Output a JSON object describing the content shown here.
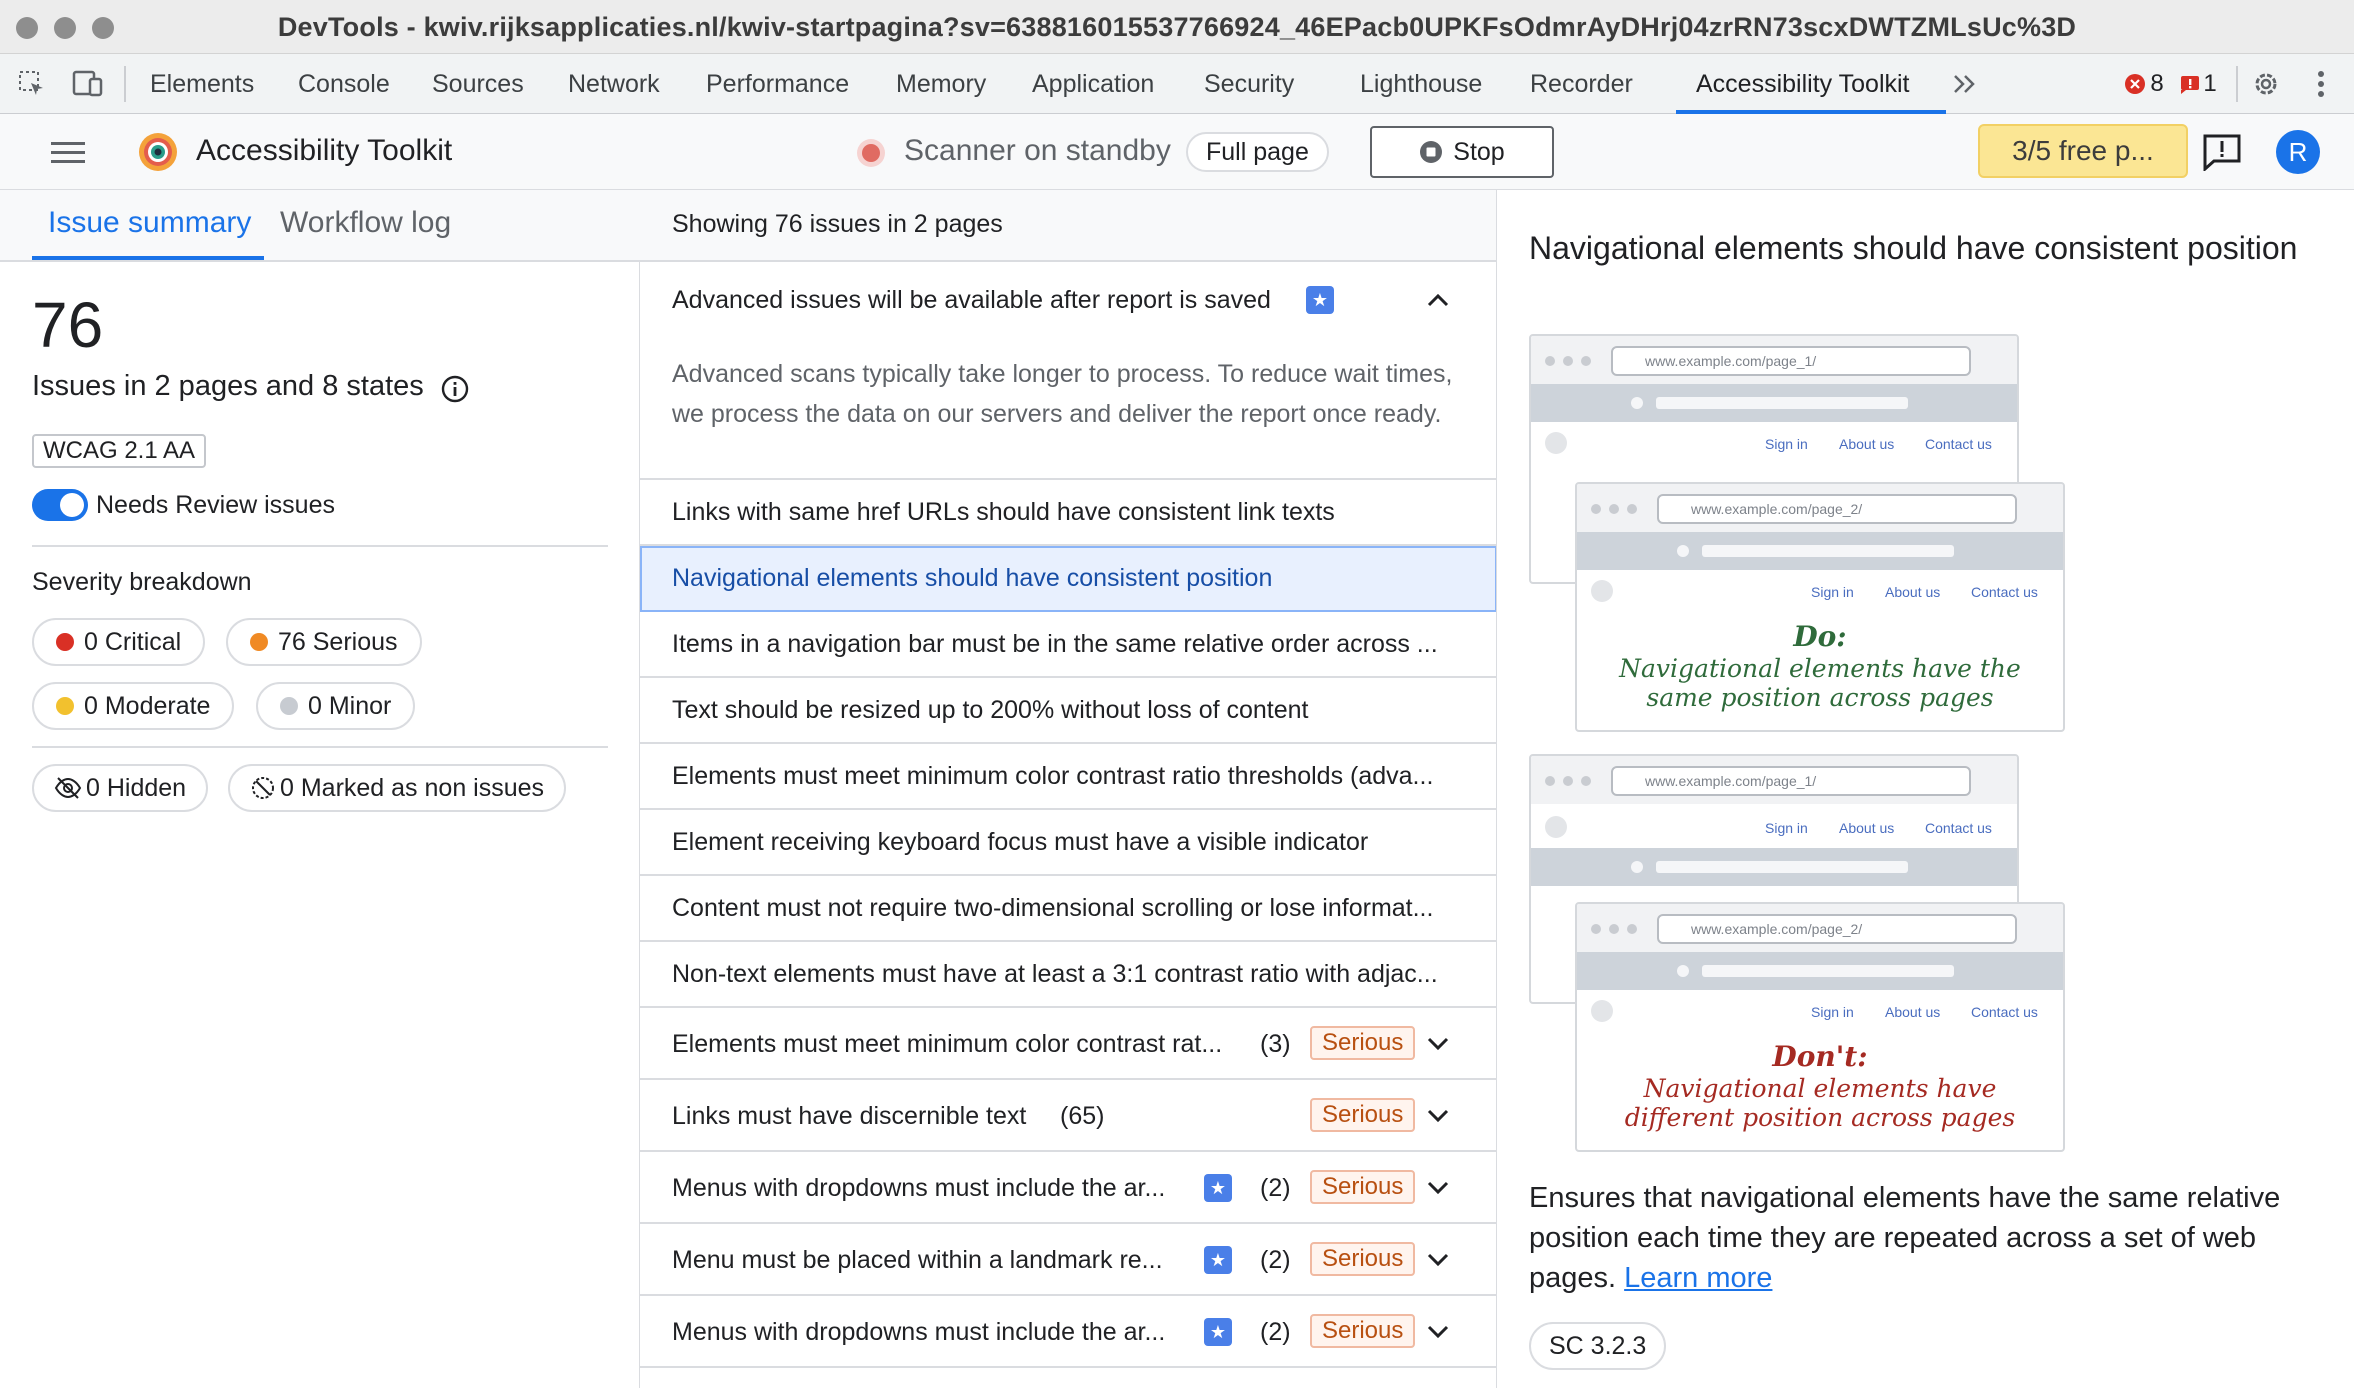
{
  "window": {
    "title": "DevTools - kwiv.rijksapplicaties.nl/kwiv-startpagina?sv=638816015537766924_46EPacb0UPKFsOdmrAyDHrj04zrRN73scxDWTZMLsUc%3D"
  },
  "devtools": {
    "tabs": [
      "Elements",
      "Console",
      "Sources",
      "Network",
      "Performance",
      "Memory",
      "Application",
      "Security",
      "Lighthouse",
      "Recorder",
      "Accessibility Toolkit"
    ],
    "active_tab": "Accessibility Toolkit",
    "error_count": "8",
    "issue_count": "1"
  },
  "toolbar": {
    "app_name": "Accessibility Toolkit",
    "scanner_status": "Scanner on standby",
    "scope": "Full page",
    "stop_label": "Stop",
    "free_badge": "3/5 free p...",
    "avatar_letter": "R"
  },
  "left": {
    "tabs": [
      "Issue summary",
      "Workflow log"
    ],
    "total": "76",
    "summary": "Issues in 2 pages and 8 states",
    "standard": "WCAG 2.1 AA",
    "toggle_label": "Needs Review issues",
    "severity_heading": "Severity breakdown",
    "severities": [
      {
        "label": "0 Critical",
        "color": "#d93025"
      },
      {
        "label": "76 Serious",
        "color": "#f08a24"
      },
      {
        "label": "0 Moderate",
        "color": "#f2c12e"
      },
      {
        "label": "0 Minor",
        "color": "#c7cbd1"
      }
    ],
    "hidden": "0 Hidden",
    "non_issues": "0 Marked as non issues"
  },
  "middle": {
    "heading": "Showing 76 issues in 2 pages",
    "advanced_title": "Advanced issues will be available after report is saved",
    "advanced_body": "Advanced scans typically take longer to process. To reduce wait times, we process the data on our servers and deliver the report once ready.",
    "advanced_items": [
      "Links with same href URLs should have consistent link texts",
      "Navigational elements should have consistent position",
      "Items in a navigation bar must be in the same relative order across ...",
      "Text should be resized up to 200% without loss of content",
      "Elements must meet minimum color contrast ratio thresholds (adva...",
      "Element receiving keyboard focus must have a visible indicator",
      "Content must not require two-dimensional scrolling or lose informat...",
      "Non-text elements must have at least a 3:1 contrast ratio with adjac..."
    ],
    "issues": [
      {
        "title": "Elements must meet minimum color contrast rat...",
        "count": "(3)",
        "severity": "Serious"
      },
      {
        "title": "Links must have discernible text",
        "count": "(65)",
        "severity": "Serious"
      },
      {
        "title": "Menus with dropdowns must include the ar...",
        "count": "(2)",
        "severity": "Serious"
      },
      {
        "title": "Menu must be placed within a landmark re...",
        "count": "(2)",
        "severity": "Serious"
      },
      {
        "title": "Menus with dropdowns must include the ar...",
        "count": "(2)",
        "severity": "Serious"
      }
    ]
  },
  "detail": {
    "title": "Navigational elements should have consistent position",
    "mock_urls": [
      "www.example.com/page_1/",
      "www.example.com/page_2/"
    ],
    "mock_nav": [
      "Sign in",
      "About us",
      "Contact us"
    ],
    "do_label": "Do:",
    "do_text": "Navigational elements have the same position across pages",
    "dont_label": "Don't:",
    "dont_text": "Navigational elements have different position across pages",
    "description": "Ensures that navigational elements have the same relative position each time they are repeated across a set of web pages.",
    "learn_more": "Learn more",
    "criterion": "SC 3.2.3"
  }
}
